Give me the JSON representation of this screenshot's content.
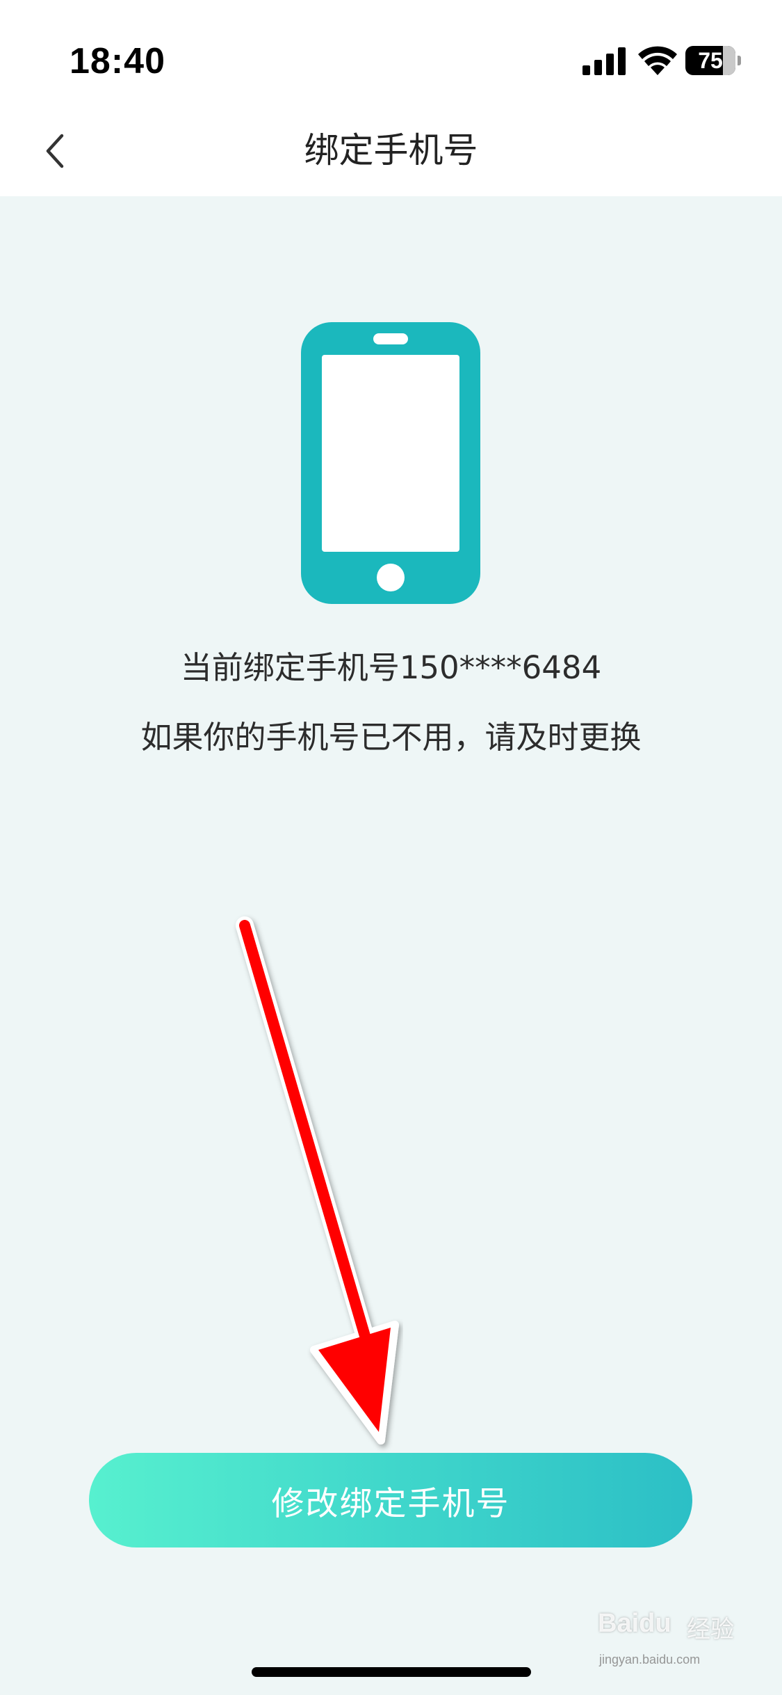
{
  "status_bar": {
    "time": "18:40",
    "battery_level": "75",
    "icons": [
      "signal-icon",
      "wifi-icon",
      "battery-icon"
    ]
  },
  "nav": {
    "title": "绑定手机号",
    "back_icon": "chevron-left-icon"
  },
  "content": {
    "illustration_icon": "smartphone-icon",
    "current_binding": "当前绑定手机号150****6484",
    "hint": "如果你的手机号已不用，请及时更换"
  },
  "actions": {
    "change_binding_label": "修改绑定手机号"
  },
  "watermark": {
    "brand": "Baidu",
    "brand_cn": "经验",
    "url": "jingyan.baidu.com"
  },
  "colors": {
    "background": "#eef6f6",
    "icon_teal": "#1bb8bd",
    "button_gradient_start": "#57f0cf",
    "button_gradient_end": "#2cbfc6",
    "annotation_arrow": "#ff0000"
  }
}
